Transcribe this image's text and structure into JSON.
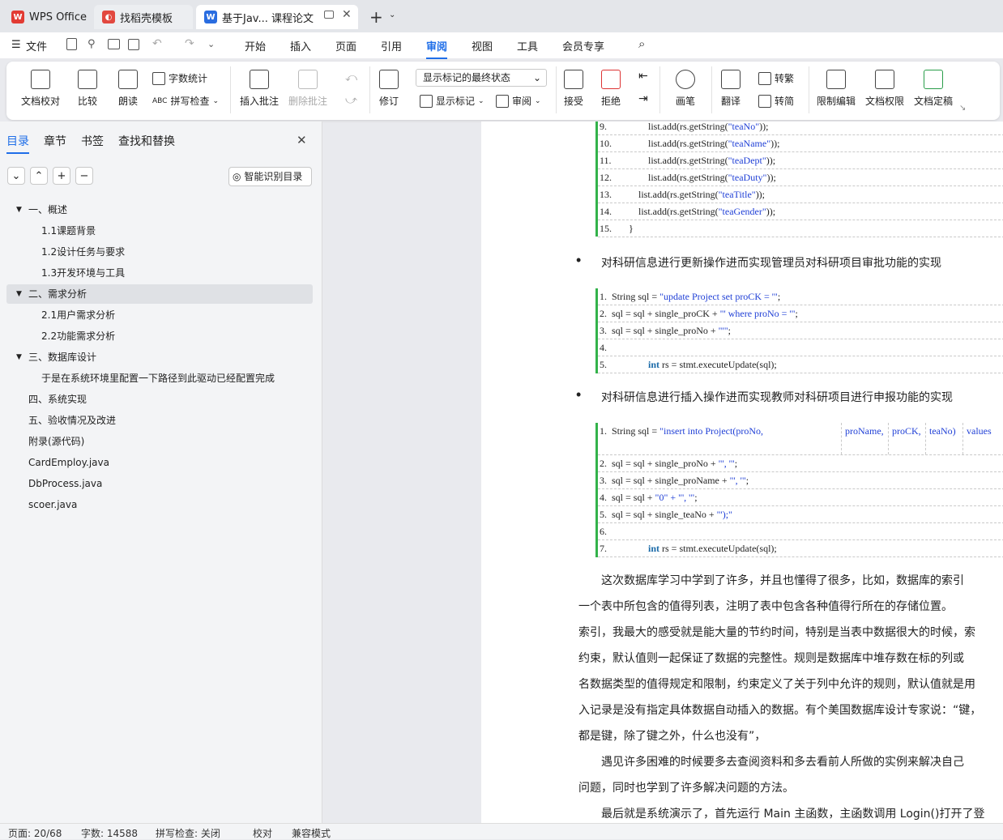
{
  "tabs": [
    {
      "label": "WPS Office"
    },
    {
      "label": "找稻壳模板"
    },
    {
      "label": "基于Jav... 课程论文"
    }
  ],
  "menu": {
    "file": "文件",
    "items": [
      "开始",
      "插入",
      "页面",
      "引用",
      "审阅",
      "视图",
      "工具",
      "会员专享"
    ],
    "active": "审阅"
  },
  "ribbon": {
    "doc_check": "文档校对",
    "compare": "比较",
    "read_aloud": "朗读",
    "word_count": "字数统计",
    "spell_check": "拼写检查",
    "insert_comment": "插入批注",
    "delete_comment": "删除批注",
    "revise": "修订",
    "markup_state": "显示标记的最终状态",
    "show_markup": "显示标记",
    "review": "审阅",
    "accept": "接受",
    "reject": "拒绝",
    "pen": "画笔",
    "translate": "翻译",
    "to_trad": "转繁",
    "to_simp": "转简",
    "restrict_edit": "限制编辑",
    "doc_perm": "文档权限",
    "finalize": "文档定稿"
  },
  "sidebar": {
    "tabs": [
      "目录",
      "章节",
      "书签",
      "查找和替换"
    ],
    "smart_toc": "智能识别目录",
    "items": [
      {
        "label": "一、概述",
        "level": 1,
        "expanded": true
      },
      {
        "label": "1.1课题背景",
        "level": 2
      },
      {
        "label": "1.2设计任务与要求",
        "level": 2
      },
      {
        "label": "1.3开发环境与工具",
        "level": 2
      },
      {
        "label": "二、需求分析",
        "level": 1,
        "expanded": true,
        "selected": true
      },
      {
        "label": "2.1用户需求分析",
        "level": 2
      },
      {
        "label": "2.2功能需求分析",
        "level": 2
      },
      {
        "label": "三、数据库设计",
        "level": 1,
        "expanded": true
      },
      {
        "label": "于是在系统环境里配置一下路径到此驱动已经配置完成",
        "level": 2
      },
      {
        "label": "四、系统实现",
        "level": 1
      },
      {
        "label": "五、验收情况及改进",
        "level": 1
      },
      {
        "label": "附录(源代码)",
        "level": 1
      },
      {
        "label": "CardEmploy.java",
        "level": 1
      },
      {
        "label": "DbProcess.java",
        "level": 1
      },
      {
        "label": "scoer.java",
        "level": 1
      }
    ]
  },
  "doc": {
    "code1": [
      {
        "n": "9.",
        "pre": "                list.add(rs.getString(",
        "s": "\"teaNo\"",
        "post": "));"
      },
      {
        "n": "10.",
        "pre": "                list.add(rs.getString(",
        "s": "\"teaName\"",
        "post": "));"
      },
      {
        "n": "11.",
        "pre": "                list.add(rs.getString(",
        "s": "\"teaDept\"",
        "post": "));"
      },
      {
        "n": "12.",
        "pre": "                list.add(rs.getString(",
        "s": "\"teaDuty\"",
        "post": "));"
      },
      {
        "n": "13.",
        "pre": "            list.add(rs.getString(",
        "s": "\"teaTitle\"",
        "post": "));"
      },
      {
        "n": "14.",
        "pre": "            list.add(rs.getString(",
        "s": "\"teaGender\"",
        "post": "));"
      },
      {
        "n": "15.",
        "pre": "        }",
        "s": "",
        "post": ""
      }
    ],
    "bullet1": "对科研信息进行更新操作进而实现管理员对科研项目审批功能的实现",
    "code2": [
      {
        "n": "1.",
        "pre": " String sql = ",
        "s": "\"update Project set proCK = '\"",
        "post": ";"
      },
      {
        "n": "2.",
        "pre": " sql = sql + single_proCK + ",
        "s": "\"' where proNo = '\"",
        "post": ";"
      },
      {
        "n": "3.",
        "pre": " sql = sql + single_proNo + ",
        "s": "\"'\"",
        "post": ";"
      },
      {
        "n": "4.",
        "pre": "",
        "s": "",
        "post": ""
      },
      {
        "n": "5.",
        "pre": "                ",
        "kw": "int",
        "post": " rs = stmt.executeUpdate(sql);"
      }
    ],
    "bullet2": "对科研信息进行插入操作进而实现教师对科研项目进行申报功能的实现",
    "code3_first": {
      "n": "1.",
      "pre": " String sql = ",
      "s": "\"insert into Project(proNo,",
      "cols": [
        "proName,",
        "proCK,",
        "teaNo)",
        "values"
      ]
    },
    "code3": [
      {
        "n": "2.",
        "pre": " sql = sql + single_proNo + ",
        "s": "\"', '\"",
        "post": ";"
      },
      {
        "n": "3.",
        "pre": " sql = sql + single_proName + ",
        "s": "\"', '\"",
        "post": ";"
      },
      {
        "n": "4.",
        "pre": " sql = sql + ",
        "s": "\"0\" + \"', '\"",
        "post": ";"
      },
      {
        "n": "5.",
        "pre": " sql = sql + single_teaNo + ",
        "s": "\"');\"",
        "post": ""
      },
      {
        "n": "6.",
        "pre": "",
        "s": "",
        "post": ""
      },
      {
        "n": "7.",
        "pre": "                ",
        "kw": "int",
        "post": " rs = stmt.executeUpdate(sql);"
      }
    ],
    "paragraphs": [
      "　　这次数据库学习中学到了许多，并且也懂得了很多，比如，数据库的索引",
      "一个表中所包含的值得列表，注明了表中包含各种值得行所在的存储位置。",
      "索引，我最大的感受就是能大量的节约时间，特别是当表中数据很大的时候，索",
      "约束，默认值则一起保证了数据的完整性。规则是数据库中堆存数在标的列或",
      "名数据类型的值得规定和限制，约束定义了关于列中允许的规则，默认值就是用",
      "入记录是没有指定具体数据自动插入的数据。有个美国数据库设计专家说：“键，",
      "都是键，除了键之外，什么也没有”，",
      "　　遇见许多困难的时候要多去查阅资料和多去看前人所做的实例来解决自己",
      "问题，同时也学到了许多解决问题的方法。",
      "　　最后就是系统演示了，首先运行 Main 主函数，主函数调用 Login()打开了登"
    ]
  },
  "status": {
    "page": "页面: 20/68",
    "words": "字数: 14588",
    "spell": "拼写检查: 关闭",
    "proof": "校对",
    "compat": "兼容模式"
  }
}
